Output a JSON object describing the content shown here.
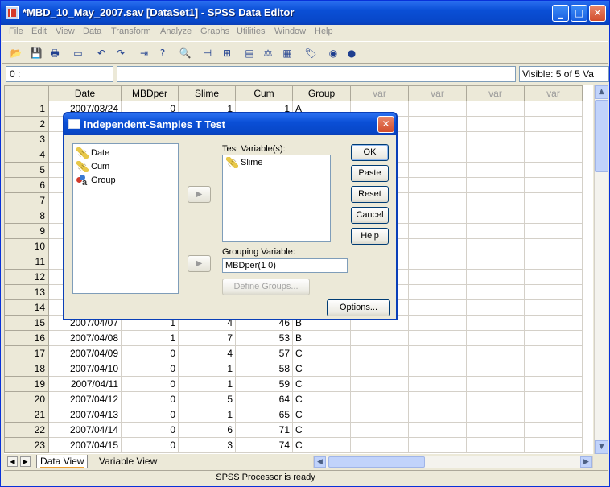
{
  "window": {
    "title": "*MBD_10_May_2007.sav [DataSet1] - SPSS Data Editor",
    "minimize": "_",
    "maximize": "□",
    "close": "✕"
  },
  "menu": [
    "File",
    "Edit",
    "View",
    "Data",
    "Transform",
    "Analyze",
    "Graphs",
    "Utilities",
    "Window",
    "Help"
  ],
  "toolbar_icons": [
    "open-icon",
    "save-icon",
    "print-icon",
    "dialog-recall-icon",
    "undo-icon",
    "redo-icon",
    "goto-case-icon",
    "variables-icon",
    "find-icon",
    "insert-cases-icon",
    "insert-variable-icon",
    "split-file-icon",
    "weight-cases-icon",
    "select-cases-icon",
    "value-labels-icon",
    "use-sets-icon",
    "show-all-icon"
  ],
  "cell_editor": {
    "reference": "0 :",
    "value": "",
    "visible": "Visible: 5 of 5 Va"
  },
  "grid": {
    "columns": [
      "Date",
      "MBDper",
      "Slime",
      "Cum",
      "Group",
      "var",
      "var",
      "var",
      "var"
    ],
    "rows": [
      {
        "n": "1",
        "date": "2007/03/24",
        "mbd": "0",
        "slime": "1",
        "cum": "1",
        "group": "A"
      },
      {
        "n": "2",
        "date": "",
        "mbd": "",
        "slime": "",
        "cum": "",
        "group": ""
      },
      {
        "n": "3",
        "date": "",
        "mbd": "",
        "slime": "",
        "cum": "",
        "group": ""
      },
      {
        "n": "4",
        "date": "",
        "mbd": "",
        "slime": "",
        "cum": "",
        "group": ""
      },
      {
        "n": "5",
        "date": "",
        "mbd": "",
        "slime": "",
        "cum": "",
        "group": ""
      },
      {
        "n": "6",
        "date": "",
        "mbd": "",
        "slime": "",
        "cum": "",
        "group": ""
      },
      {
        "n": "7",
        "date": "",
        "mbd": "",
        "slime": "",
        "cum": "",
        "group": ""
      },
      {
        "n": "8",
        "date": "",
        "mbd": "",
        "slime": "",
        "cum": "",
        "group": ""
      },
      {
        "n": "9",
        "date": "",
        "mbd": "",
        "slime": "",
        "cum": "",
        "group": ""
      },
      {
        "n": "10",
        "date": "",
        "mbd": "",
        "slime": "",
        "cum": "",
        "group": ""
      },
      {
        "n": "11",
        "date": "",
        "mbd": "",
        "slime": "",
        "cum": "",
        "group": ""
      },
      {
        "n": "12",
        "date": "",
        "mbd": "",
        "slime": "",
        "cum": "",
        "group": ""
      },
      {
        "n": "13",
        "date": "",
        "mbd": "",
        "slime": "",
        "cum": "",
        "group": ""
      },
      {
        "n": "14",
        "date": "",
        "mbd": "",
        "slime": "",
        "cum": "",
        "group": ""
      },
      {
        "n": "15",
        "date": "2007/04/07",
        "mbd": "1",
        "slime": "4",
        "cum": "46",
        "group": "B"
      },
      {
        "n": "16",
        "date": "2007/04/08",
        "mbd": "1",
        "slime": "7",
        "cum": "53",
        "group": "B"
      },
      {
        "n": "17",
        "date": "2007/04/09",
        "mbd": "0",
        "slime": "4",
        "cum": "57",
        "group": "C"
      },
      {
        "n": "18",
        "date": "2007/04/10",
        "mbd": "0",
        "slime": "1",
        "cum": "58",
        "group": "C"
      },
      {
        "n": "19",
        "date": "2007/04/11",
        "mbd": "0",
        "slime": "1",
        "cum": "59",
        "group": "C"
      },
      {
        "n": "20",
        "date": "2007/04/12",
        "mbd": "0",
        "slime": "5",
        "cum": "64",
        "group": "C"
      },
      {
        "n": "21",
        "date": "2007/04/13",
        "mbd": "0",
        "slime": "1",
        "cum": "65",
        "group": "C"
      },
      {
        "n": "22",
        "date": "2007/04/14",
        "mbd": "0",
        "slime": "6",
        "cum": "71",
        "group": "C"
      },
      {
        "n": "23",
        "date": "2007/04/15",
        "mbd": "0",
        "slime": "3",
        "cum": "74",
        "group": "C"
      }
    ]
  },
  "tabs": {
    "data_view": "Data View",
    "variable_view": "Variable View"
  },
  "status": "SPSS Processor is ready",
  "dialog": {
    "title": "Independent-Samples T Test",
    "close": "✕",
    "source_variables": [
      {
        "name": "Date",
        "icon": "scale-ruler-icon"
      },
      {
        "name": "Cum",
        "icon": "scale-ruler-icon"
      },
      {
        "name": "Group",
        "icon": "nominal-icon"
      }
    ],
    "test_variables_label": "Test Variable(s):",
    "test_variables": [
      {
        "name": "Slime",
        "icon": "scale-ruler-icon"
      }
    ],
    "grouping_label": "Grouping Variable:",
    "grouping_value": "MBDper(1 0)",
    "arrow": "▶",
    "buttons": {
      "ok": "OK",
      "paste": "Paste",
      "reset": "Reset",
      "cancel": "Cancel",
      "help": "Help",
      "define_groups": "Define Groups...",
      "options": "Options..."
    }
  }
}
